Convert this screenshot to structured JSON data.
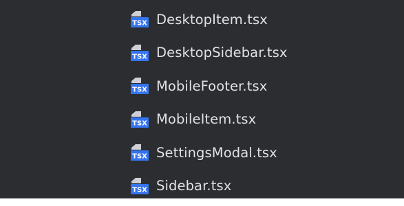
{
  "project_tree": {
    "files": [
      {
        "name": "DesktopItem.tsx",
        "icon": "tsx-file-icon"
      },
      {
        "name": "DesktopSidebar.tsx",
        "icon": "tsx-file-icon"
      },
      {
        "name": "MobileFooter.tsx",
        "icon": "tsx-file-icon"
      },
      {
        "name": "MobileItem.tsx",
        "icon": "tsx-file-icon"
      },
      {
        "name": "SettingsModal.tsx",
        "icon": "tsx-file-icon"
      },
      {
        "name": "Sidebar.tsx",
        "icon": "tsx-file-icon"
      }
    ],
    "icon_badge_text": "TSX"
  },
  "colors": {
    "panel_background": "#2b2d30",
    "text": "#dfe1e5",
    "icon_badge": "#3574f0",
    "icon_page": "#ced0d6"
  }
}
